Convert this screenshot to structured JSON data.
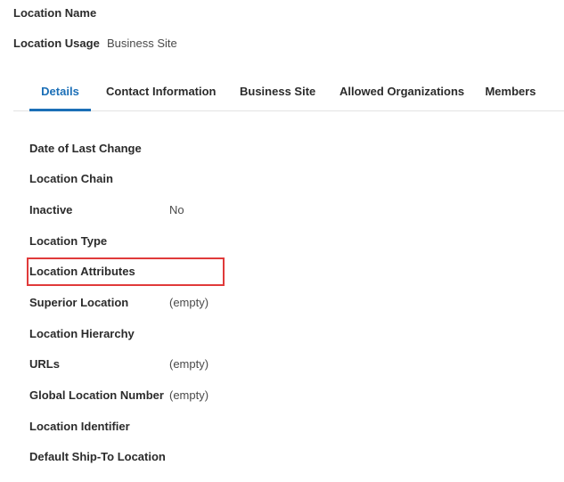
{
  "header": {
    "location_name_label": "Location Name",
    "location_usage_label": "Location Usage",
    "location_usage_value": "Business Site"
  },
  "tabs": [
    {
      "label": "Details",
      "active": true
    },
    {
      "label": "Contact Information",
      "active": false
    },
    {
      "label": "Business Site",
      "active": false
    },
    {
      "label": "Allowed Organizations",
      "active": false
    },
    {
      "label": "Members",
      "active": false
    }
  ],
  "details": {
    "date_of_last_change": {
      "label": "Date of Last Change",
      "value": ""
    },
    "location_chain": {
      "label": "Location Chain",
      "value": ""
    },
    "inactive": {
      "label": "Inactive",
      "value": "No"
    },
    "location_type": {
      "label": "Location Type",
      "value": ""
    },
    "location_attributes": {
      "label": "Location Attributes",
      "value": ""
    },
    "superior_location": {
      "label": "Superior Location",
      "value": "(empty)"
    },
    "location_hierarchy": {
      "label": "Location Hierarchy",
      "value": ""
    },
    "urls": {
      "label": "URLs",
      "value": "(empty)"
    },
    "global_location_number": {
      "label": "Global Location Number",
      "value": "(empty)"
    },
    "location_identifier": {
      "label": "Location Identifier",
      "value": ""
    },
    "default_ship_to_location": {
      "label": "Default Ship-To Location",
      "value": ""
    }
  },
  "colors": {
    "accent": "#1b6fb7",
    "highlight": "#e03a3a"
  }
}
